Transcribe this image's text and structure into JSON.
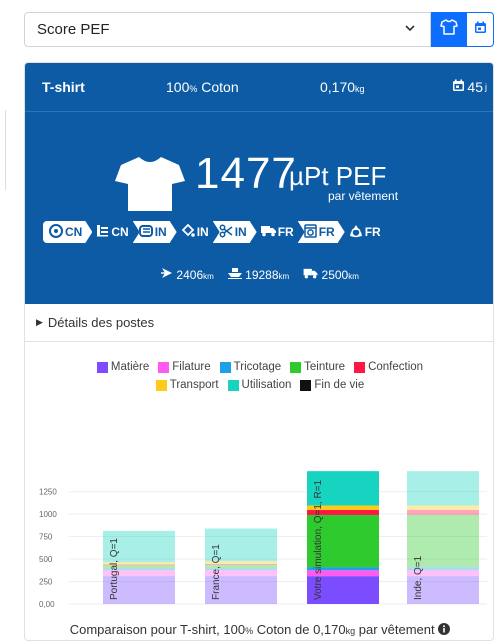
{
  "selector": {
    "value": "Score PEF",
    "icons": [
      "chevron-down-icon",
      "tshirt-icon",
      "calendar-icon"
    ]
  },
  "header": {
    "title": "T-shirt",
    "material_pct": "100",
    "material_pct_unit": "%",
    "material_name": "Coton",
    "mass_value": "0,170",
    "mass_unit": "kg",
    "days_value": "45",
    "days_unit": "j"
  },
  "score": {
    "value": "1477",
    "unit": "µPt PEF",
    "sub": "par vêtement"
  },
  "chain": [
    {
      "icon": "spinning-icon",
      "country": "CN",
      "style": "white"
    },
    {
      "icon": "weaving-icon",
      "country": "CN",
      "style": "plain"
    },
    {
      "icon": "fabric-roll-icon",
      "country": "IN",
      "style": "white"
    },
    {
      "icon": "dye-bucket-icon",
      "country": "IN",
      "style": "plain"
    },
    {
      "icon": "scissors-icon",
      "country": "IN",
      "style": "white"
    },
    {
      "icon": "truck-icon",
      "country": "FR",
      "style": "plain"
    },
    {
      "icon": "washing-machine-icon",
      "country": "FR",
      "style": "white"
    },
    {
      "icon": "recycle-icon",
      "country": "FR",
      "style": "plain"
    }
  ],
  "transport": {
    "plane": {
      "value": "2406",
      "unit": "km"
    },
    "ship": {
      "value": "19288",
      "unit": "km"
    },
    "truck": {
      "value": "2500",
      "unit": "km"
    }
  },
  "details_label": "Détails des postes",
  "colors": {
    "Matière": "#7c4dff",
    "Filature": "#ff5bf0",
    "Tricotage": "#1ea0e6",
    "Teinture": "#2eca2e",
    "Confection": "#ff1744",
    "Transport": "#ffca1a",
    "Utilisation": "#17d4c0",
    "Fin de vie": "#111111",
    "hero": "#0d5ba5",
    "primary": "#0d6efd"
  },
  "chart_data": {
    "type": "bar",
    "stacked": true,
    "legend": [
      "Matière",
      "Filature",
      "Tricotage",
      "Teinture",
      "Confection",
      "Transport",
      "Utilisation",
      "Fin de vie"
    ],
    "legend_rows": [
      [
        "Matière",
        "Filature",
        "Tricotage",
        "Teinture",
        "Confection"
      ],
      [
        "Transport",
        "Utilisation",
        "Fin de vie"
      ]
    ],
    "yticks": [
      "1250",
      "1000",
      "750",
      "500",
      "250",
      "0,00"
    ],
    "ytick_values": [
      1250,
      1000,
      750,
      500,
      250,
      0
    ],
    "ylim": [
      0,
      1490
    ],
    "categories": [
      {
        "label": "Portugal, Q=1",
        "total_value": "813",
        "total_unit": "µPt PEF",
        "highlight": false,
        "values": {
          "Matière": 310,
          "Filature": 65,
          "Tricotage": 20,
          "Teinture": 35,
          "Confection": 10,
          "Transport": 25,
          "Utilisation": 348,
          "Fin de vie": 0
        }
      },
      {
        "label": "France, Q=1",
        "total_value": "839",
        "total_unit": "µPt PEF",
        "highlight": false,
        "values": {
          "Matière": 310,
          "Filature": 65,
          "Tricotage": 20,
          "Teinture": 40,
          "Confection": 10,
          "Transport": 30,
          "Utilisation": 364,
          "Fin de vie": 0
        }
      },
      {
        "label": "Votre simulation, Q=1, R=1",
        "total_value": "1477",
        "total_unit": "µPt PEF",
        "highlight": true,
        "values": {
          "Matière": 310,
          "Filature": 65,
          "Tricotage": 35,
          "Teinture": 580,
          "Confection": 55,
          "Transport": 50,
          "Utilisation": 382,
          "Fin de vie": 0
        }
      },
      {
        "label": "Inde, Q=1",
        "total_value": "1477",
        "total_unit": "µPt PEF",
        "highlight": false,
        "values": {
          "Matière": 310,
          "Filature": 65,
          "Tricotage": 35,
          "Teinture": 580,
          "Confection": 55,
          "Transport": 50,
          "Utilisation": 382,
          "Fin de vie": 0
        }
      }
    ]
  },
  "caption": {
    "prefix": "Comparaison pour T-shirt, 100",
    "pct_unit": "%",
    "middle": " Coton de 0,170",
    "mass_unit": "kg",
    "suffix": " par vêtement"
  }
}
